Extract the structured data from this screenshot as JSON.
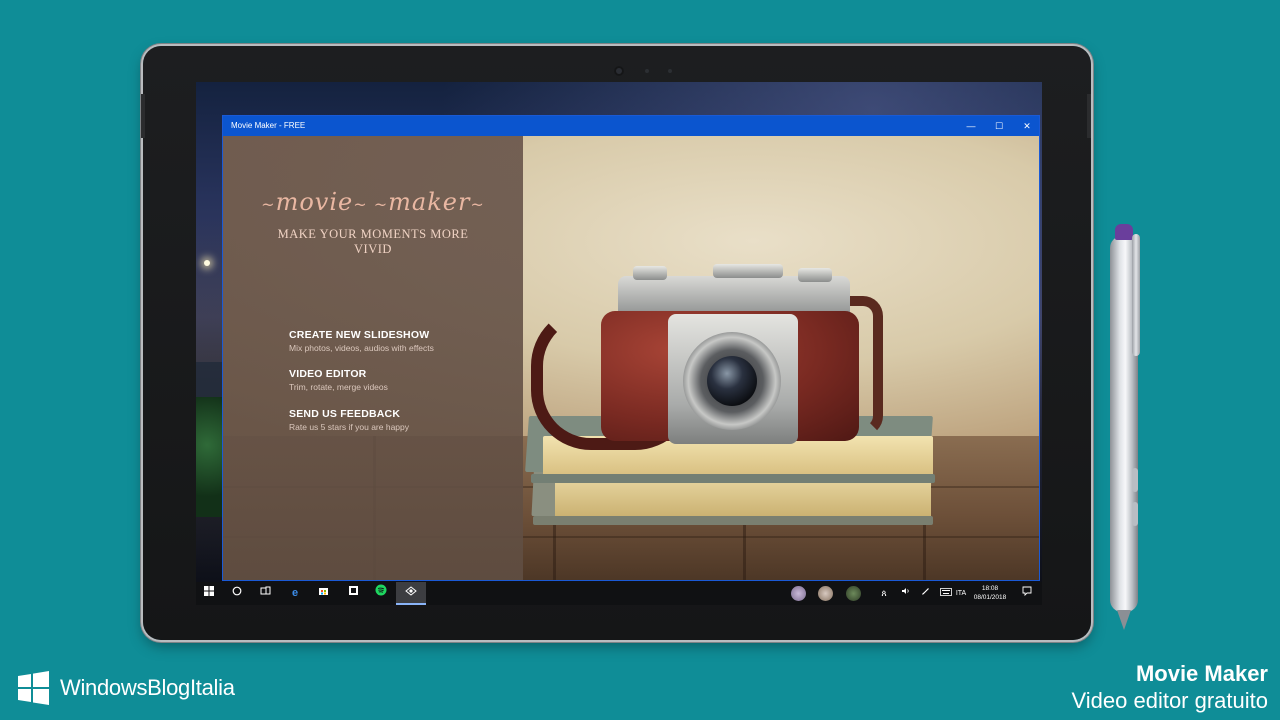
{
  "window": {
    "title": "Movie Maker - FREE",
    "controls": {
      "minimize": "—",
      "maximize": "☐",
      "close": "✕"
    }
  },
  "app": {
    "logo": {
      "word1": "movie",
      "word2": "maker"
    },
    "tagline": "MAKE YOUR MOMENTS MORE VIVID",
    "menu": [
      {
        "title": "CREATE NEW SLIDESHOW",
        "subtitle": "Mix photos, videos, audios with effects"
      },
      {
        "title": "VIDEO EDITOR",
        "subtitle": "Trim, rotate, merge videos"
      },
      {
        "title": "SEND US FEEDBACK",
        "subtitle": "Rate us 5 stars if you are happy"
      }
    ]
  },
  "taskbar": {
    "pinned_icons": [
      "windows-start-icon",
      "cortana-icon",
      "task-view-icon",
      "edge-icon",
      "store-icon",
      "photos-icon",
      "spotify-icon",
      "movie-maker-icon"
    ],
    "tray_icons": [
      "people-icon",
      "volume-icon",
      "pen-icon",
      "keyboard-icon"
    ],
    "language": "ITA",
    "time": "18:08",
    "date": "08/01/2018"
  },
  "branding": {
    "site_name": "WindowsBlogItalia",
    "caption_title": "Movie Maker",
    "caption_subtitle": "Video editor gratuito"
  },
  "colors": {
    "background": "#0f8d97",
    "titlebar": "#0b55cf",
    "logo_accent": "#e9b7a2"
  }
}
